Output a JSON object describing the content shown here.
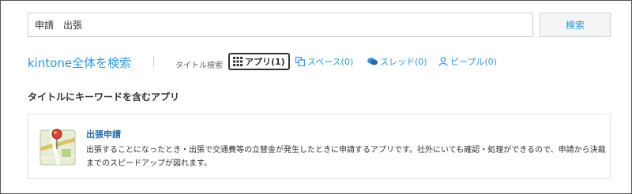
{
  "search": {
    "value": "申請　出張",
    "button_label": "検索"
  },
  "scope": {
    "label": "kintone全体を検索"
  },
  "filters": {
    "title_label": "タイトル検索",
    "items": [
      {
        "label": "アプリ(1)",
        "icon": "grid-icon",
        "active": true
      },
      {
        "label": "スペース(0)",
        "icon": "space-icon",
        "active": false
      },
      {
        "label": "スレッド(0)",
        "icon": "thread-icon",
        "active": false
      },
      {
        "label": "ピープル(0)",
        "icon": "people-icon",
        "active": false
      }
    ]
  },
  "results": {
    "section_title": "タイトルにキーワードを含むアプリ",
    "items": [
      {
        "name": "出張申請",
        "icon": "map-pin-icon",
        "description": "出張することになったとき・出張で交通費等の立替金が発生したときに申請するアプリです。社外にいても確認・処理ができるので、申請から決裁までのスピードアップが図れます。"
      }
    ]
  },
  "colors": {
    "link": "#3498db",
    "app_name": "#2b6aa8",
    "text": "#333333",
    "border": "#d0d0d0"
  }
}
